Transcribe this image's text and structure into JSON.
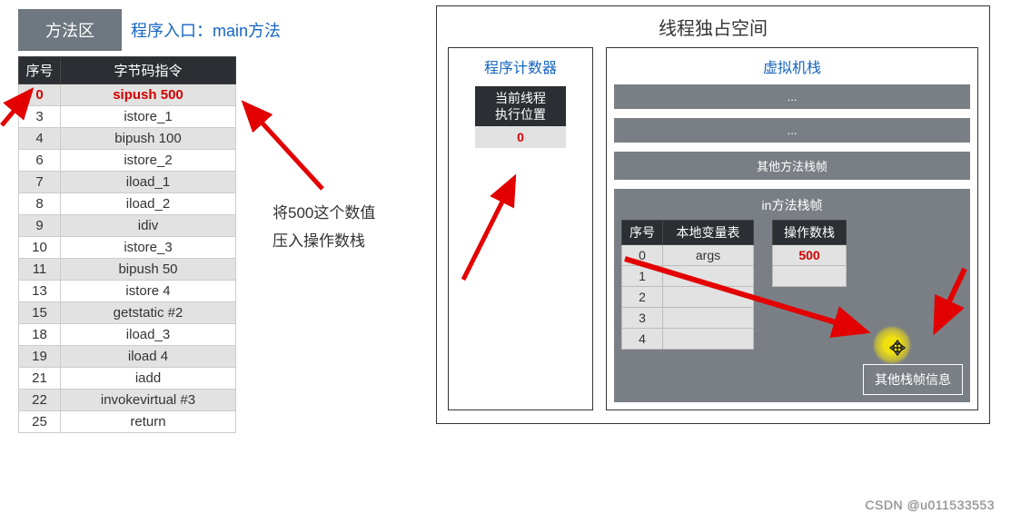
{
  "left": {
    "method_area_label": "方法区",
    "entry_label": "程序入口：main方法",
    "headers": {
      "seq": "序号",
      "instr": "字节码指令"
    },
    "rows": [
      {
        "seq": "0",
        "instr": "sipush 500",
        "hl": true
      },
      {
        "seq": "3",
        "instr": "istore_1"
      },
      {
        "seq": "4",
        "instr": "bipush 100"
      },
      {
        "seq": "6",
        "instr": "istore_2"
      },
      {
        "seq": "7",
        "instr": "iload_1"
      },
      {
        "seq": "8",
        "instr": "iload_2"
      },
      {
        "seq": "9",
        "instr": "idiv"
      },
      {
        "seq": "10",
        "instr": "istore_3"
      },
      {
        "seq": "11",
        "instr": "bipush 50"
      },
      {
        "seq": "13",
        "instr": "istore 4"
      },
      {
        "seq": "15",
        "instr": "getstatic #2"
      },
      {
        "seq": "18",
        "instr": "iload_3"
      },
      {
        "seq": "19",
        "instr": "iload 4"
      },
      {
        "seq": "21",
        "instr": "iadd"
      },
      {
        "seq": "22",
        "instr": "invokevirtual #3"
      },
      {
        "seq": "25",
        "instr": "return"
      }
    ],
    "note_line1": "将500这个数值",
    "note_line2": "压入操作数栈"
  },
  "right": {
    "title": "线程独占空间",
    "pc": {
      "title": "程序计数器",
      "head_line1": "当前线程",
      "head_line2": "执行位置",
      "value": "0"
    },
    "vm": {
      "title": "虚拟机栈",
      "slot_ellipsis": "...",
      "other_frame_label": "其他方法栈帧",
      "main_frame_title": "in方法栈帧",
      "local_headers": {
        "seq": "序号",
        "vars": "本地变量表"
      },
      "local_rows": [
        {
          "seq": "0",
          "val": "args"
        },
        {
          "seq": "1",
          "val": ""
        },
        {
          "seq": "2",
          "val": ""
        },
        {
          "seq": "3",
          "val": ""
        },
        {
          "seq": "4",
          "val": ""
        }
      ],
      "opstack_header": "操作数栈",
      "opstack_rows": [
        "500",
        ""
      ],
      "other_info_label": "其他栈帧信息"
    }
  },
  "watermark": "CSDN @u011533553"
}
